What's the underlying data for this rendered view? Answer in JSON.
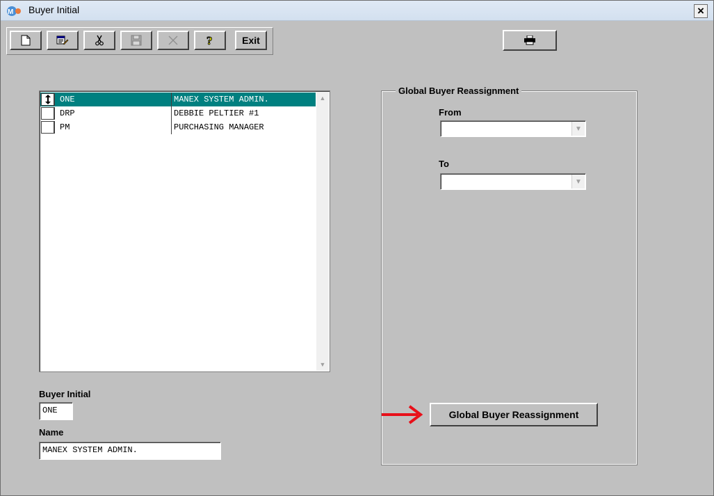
{
  "window": {
    "title": "Buyer Initial",
    "close_label": "×"
  },
  "toolbar": {
    "buttons": [
      {
        "name": "new-icon"
      },
      {
        "name": "edit-icon"
      },
      {
        "name": "cut-icon"
      },
      {
        "name": "save-icon"
      },
      {
        "name": "delete-icon"
      },
      {
        "name": "help-icon"
      }
    ],
    "exit_label": "Exit",
    "print_icon": "printer-icon"
  },
  "grid": {
    "rows": [
      {
        "code": "ONE",
        "name": "MANEX SYSTEM ADMIN.",
        "selected": true
      },
      {
        "code": "DRP",
        "name": "DEBBIE PELTIER #1",
        "selected": false
      },
      {
        "code": "PM",
        "name": "PURCHASING MANAGER",
        "selected": false
      }
    ]
  },
  "form": {
    "buyer_initial_label": "Buyer Initial",
    "buyer_initial_value": "ONE",
    "name_label": "Name",
    "name_value": "MANEX SYSTEM ADMIN."
  },
  "reassign": {
    "group_title": "Global Buyer Reassignment",
    "from_label": "From",
    "to_label": "To",
    "from_value": "",
    "to_value": "",
    "button_label": "Global Buyer Reassignment"
  },
  "colors": {
    "selection": "#008080",
    "arrow": "#e8101a",
    "background": "#c0c0c0"
  }
}
